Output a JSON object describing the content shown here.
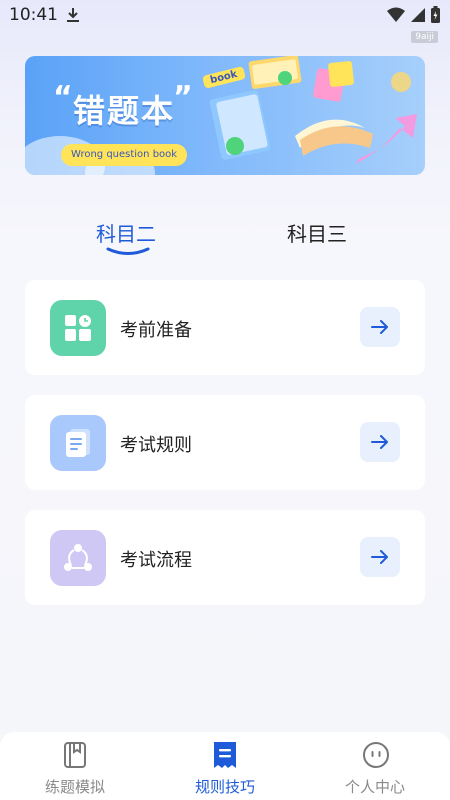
{
  "status": {
    "time": "10:41",
    "tag": "9aiji"
  },
  "banner": {
    "title": "错题本",
    "subtitle": "Wrong question book",
    "tag": "book"
  },
  "tabs": [
    {
      "label": "科目二",
      "active": true
    },
    {
      "label": "科目三",
      "active": false
    }
  ],
  "cards": [
    {
      "label": "考前准备",
      "icon": "grid-clock-icon",
      "icon_bg": "#5fd3a9"
    },
    {
      "label": "考试规则",
      "icon": "document-icon",
      "icon_bg": "#a9c8fb"
    },
    {
      "label": "考试流程",
      "icon": "flow-cycle-icon",
      "icon_bg": "#cfc8f4"
    }
  ],
  "nav": [
    {
      "label": "练题模拟",
      "icon": "book-icon",
      "active": false
    },
    {
      "label": "规则技巧",
      "icon": "receipt-icon",
      "active": true
    },
    {
      "label": "个人中心",
      "icon": "face-icon",
      "active": false
    }
  ],
  "colors": {
    "accent": "#1f5bd8",
    "arrow_bg": "#e8f0fd"
  }
}
